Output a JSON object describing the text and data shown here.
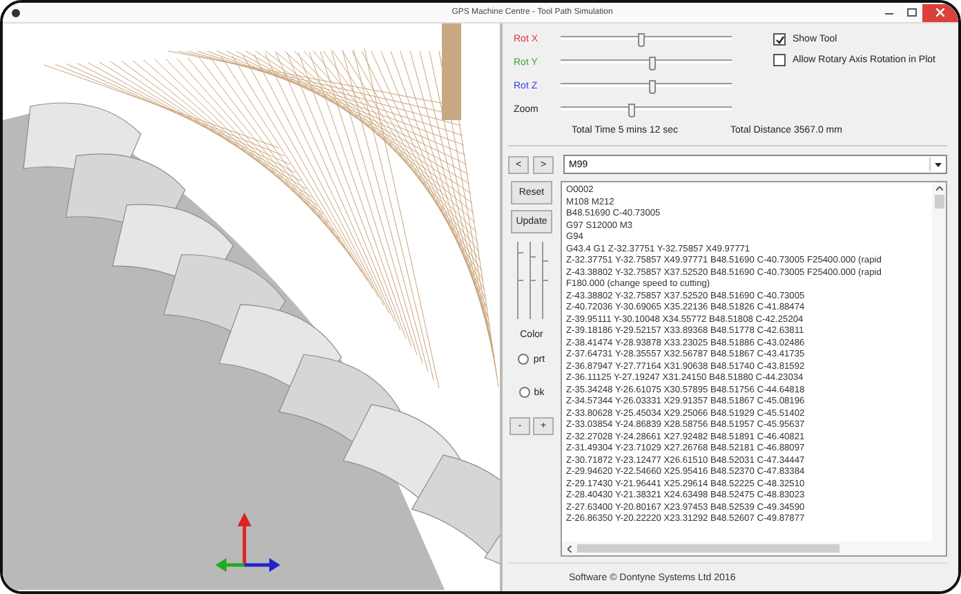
{
  "window": {
    "title": "GPS Machine Centre - Tool Path Simulation"
  },
  "sliders": [
    {
      "label": "Rot X",
      "color": "#e0303a",
      "level": 0.47
    },
    {
      "label": "Rot Y",
      "color": "#3aa040",
      "level": 0.53
    },
    {
      "label": "Rot Z",
      "color": "#3a3ae0",
      "level": 0.53
    },
    {
      "label": "Zoom",
      "color": "#222222",
      "level": 0.41
    }
  ],
  "options": [
    {
      "label": "Show Tool",
      "checked": true
    },
    {
      "label": "Allow Rotary Axis Rotation in Plot",
      "checked": false
    }
  ],
  "totals": {
    "time": "Total Time  5 mins  12 sec",
    "distance": "Total Distance  3567.0 mm"
  },
  "nav_buttons": [
    "<",
    ">"
  ],
  "block_select": {
    "value": "M99"
  },
  "side_buttons": [
    "Reset",
    "Update"
  ],
  "color_label": "Color",
  "color_options": [
    {
      "label": "prt",
      "selected": false
    },
    {
      "label": "bk",
      "selected": false
    }
  ],
  "step_buttons": [
    "-",
    "+"
  ],
  "code_lines": [
    "O0002",
    "M108 M212",
    "B48.51690 C-40.73005",
    "G97 S12000 M3",
    "G94",
    "G43.4 G1 Z-32.37751 Y-32.75857 X49.97771",
    "Z-32.37751 Y-32.75857 X49.97771 B48.51690 C-40.73005 F25400.000 (rapid",
    "Z-43.38802 Y-32.75857 X37.52520 B48.51690 C-40.73005 F25400.000 (rapid",
    "F180.000 (change speed to cutting)",
    "Z-43.38802 Y-32.75857 X37.52520 B48.51690 C-40.73005",
    "Z-40.72036 Y-30.69065 X35.22136 B48.51826 C-41.88474",
    "Z-39.95111 Y-30.10048 X34.55772 B48.51808 C-42.25204",
    "Z-39.18186 Y-29.52157 X33.89368 B48.51778 C-42.63811",
    "Z-38.41474 Y-28.93878 X33.23025 B48.51886 C-43.02486",
    "Z-37.64731 Y-28.35557 X32.56787 B48.51867 C-43.41735",
    "Z-36.87947 Y-27.77164 X31.90638 B48.51740 C-43.81592",
    "Z-36.11125 Y-27.19247 X31.24150 B48.51880 C-44.23034",
    "Z-35.34248 Y-26.61075 X30.57895 B48.51756 C-44.64818",
    "Z-34.57344 Y-26.03331 X29.91357 B48.51867 C-45.08196",
    "Z-33.80628 Y-25.45034 X29.25066 B48.51929 C-45.51402",
    "Z-33.03854 Y-24.86839 X28.58756 B48.51957 C-45.95637",
    "Z-32.27028 Y-24.28661 X27.92482 B48.51891 C-46.40821",
    "Z-31.49304 Y-23.71029 X27.26768 B48.52181 C-46.88097",
    "Z-30.71872 Y-23.12477 X26.61510 B48.52031 C-47.34447",
    "Z-29.94620 Y-22.54660 X25.95416 B48.52370 C-47.83384",
    "Z-29.17430 Y-21.96441 X25.29614 B48.52225 C-48.32510",
    "Z-28.40430 Y-21.38321 X24.63498 B48.52475 C-48.83023",
    "Z-27.63400 Y-20.80167 X23.97453 B48.52539 C-49.34590",
    "Z-26.86350 Y-20.22220 X23.31292 B48.52607 C-49.87877"
  ],
  "footer": "Software © Dontyne Systems Ltd 2016"
}
